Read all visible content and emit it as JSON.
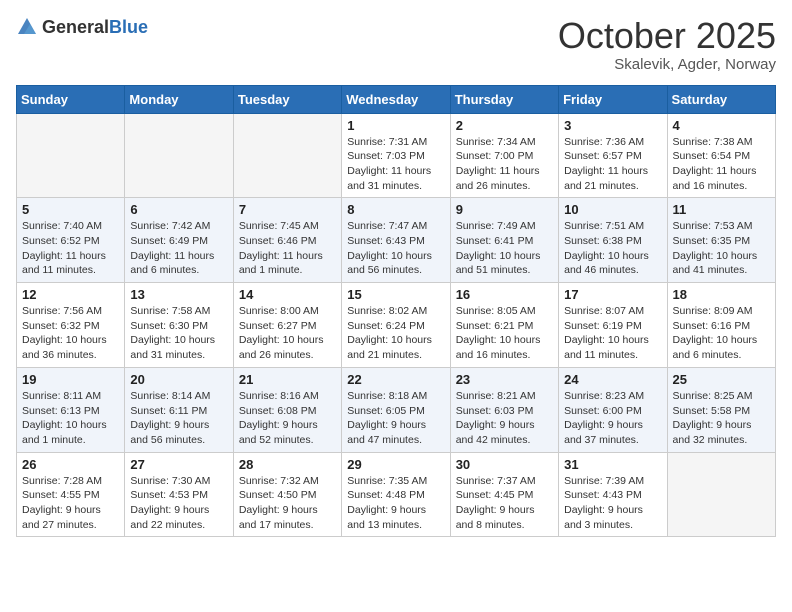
{
  "header": {
    "logo_general": "General",
    "logo_blue": "Blue",
    "month_title": "October 2025",
    "location": "Skalevik, Agder, Norway"
  },
  "weekdays": [
    "Sunday",
    "Monday",
    "Tuesday",
    "Wednesday",
    "Thursday",
    "Friday",
    "Saturday"
  ],
  "weeks": [
    [
      {
        "day": "",
        "info": ""
      },
      {
        "day": "",
        "info": ""
      },
      {
        "day": "",
        "info": ""
      },
      {
        "day": "1",
        "info": "Sunrise: 7:31 AM\nSunset: 7:03 PM\nDaylight: 11 hours\nand 31 minutes."
      },
      {
        "day": "2",
        "info": "Sunrise: 7:34 AM\nSunset: 7:00 PM\nDaylight: 11 hours\nand 26 minutes."
      },
      {
        "day": "3",
        "info": "Sunrise: 7:36 AM\nSunset: 6:57 PM\nDaylight: 11 hours\nand 21 minutes."
      },
      {
        "day": "4",
        "info": "Sunrise: 7:38 AM\nSunset: 6:54 PM\nDaylight: 11 hours\nand 16 minutes."
      }
    ],
    [
      {
        "day": "5",
        "info": "Sunrise: 7:40 AM\nSunset: 6:52 PM\nDaylight: 11 hours\nand 11 minutes."
      },
      {
        "day": "6",
        "info": "Sunrise: 7:42 AM\nSunset: 6:49 PM\nDaylight: 11 hours\nand 6 minutes."
      },
      {
        "day": "7",
        "info": "Sunrise: 7:45 AM\nSunset: 6:46 PM\nDaylight: 11 hours\nand 1 minute."
      },
      {
        "day": "8",
        "info": "Sunrise: 7:47 AM\nSunset: 6:43 PM\nDaylight: 10 hours\nand 56 minutes."
      },
      {
        "day": "9",
        "info": "Sunrise: 7:49 AM\nSunset: 6:41 PM\nDaylight: 10 hours\nand 51 minutes."
      },
      {
        "day": "10",
        "info": "Sunrise: 7:51 AM\nSunset: 6:38 PM\nDaylight: 10 hours\nand 46 minutes."
      },
      {
        "day": "11",
        "info": "Sunrise: 7:53 AM\nSunset: 6:35 PM\nDaylight: 10 hours\nand 41 minutes."
      }
    ],
    [
      {
        "day": "12",
        "info": "Sunrise: 7:56 AM\nSunset: 6:32 PM\nDaylight: 10 hours\nand 36 minutes."
      },
      {
        "day": "13",
        "info": "Sunrise: 7:58 AM\nSunset: 6:30 PM\nDaylight: 10 hours\nand 31 minutes."
      },
      {
        "day": "14",
        "info": "Sunrise: 8:00 AM\nSunset: 6:27 PM\nDaylight: 10 hours\nand 26 minutes."
      },
      {
        "day": "15",
        "info": "Sunrise: 8:02 AM\nSunset: 6:24 PM\nDaylight: 10 hours\nand 21 minutes."
      },
      {
        "day": "16",
        "info": "Sunrise: 8:05 AM\nSunset: 6:21 PM\nDaylight: 10 hours\nand 16 minutes."
      },
      {
        "day": "17",
        "info": "Sunrise: 8:07 AM\nSunset: 6:19 PM\nDaylight: 10 hours\nand 11 minutes."
      },
      {
        "day": "18",
        "info": "Sunrise: 8:09 AM\nSunset: 6:16 PM\nDaylight: 10 hours\nand 6 minutes."
      }
    ],
    [
      {
        "day": "19",
        "info": "Sunrise: 8:11 AM\nSunset: 6:13 PM\nDaylight: 10 hours\nand 1 minute."
      },
      {
        "day": "20",
        "info": "Sunrise: 8:14 AM\nSunset: 6:11 PM\nDaylight: 9 hours\nand 56 minutes."
      },
      {
        "day": "21",
        "info": "Sunrise: 8:16 AM\nSunset: 6:08 PM\nDaylight: 9 hours\nand 52 minutes."
      },
      {
        "day": "22",
        "info": "Sunrise: 8:18 AM\nSunset: 6:05 PM\nDaylight: 9 hours\nand 47 minutes."
      },
      {
        "day": "23",
        "info": "Sunrise: 8:21 AM\nSunset: 6:03 PM\nDaylight: 9 hours\nand 42 minutes."
      },
      {
        "day": "24",
        "info": "Sunrise: 8:23 AM\nSunset: 6:00 PM\nDaylight: 9 hours\nand 37 minutes."
      },
      {
        "day": "25",
        "info": "Sunrise: 8:25 AM\nSunset: 5:58 PM\nDaylight: 9 hours\nand 32 minutes."
      }
    ],
    [
      {
        "day": "26",
        "info": "Sunrise: 7:28 AM\nSunset: 4:55 PM\nDaylight: 9 hours\nand 27 minutes."
      },
      {
        "day": "27",
        "info": "Sunrise: 7:30 AM\nSunset: 4:53 PM\nDaylight: 9 hours\nand 22 minutes."
      },
      {
        "day": "28",
        "info": "Sunrise: 7:32 AM\nSunset: 4:50 PM\nDaylight: 9 hours\nand 17 minutes."
      },
      {
        "day": "29",
        "info": "Sunrise: 7:35 AM\nSunset: 4:48 PM\nDaylight: 9 hours\nand 13 minutes."
      },
      {
        "day": "30",
        "info": "Sunrise: 7:37 AM\nSunset: 4:45 PM\nDaylight: 9 hours\nand 8 minutes."
      },
      {
        "day": "31",
        "info": "Sunrise: 7:39 AM\nSunset: 4:43 PM\nDaylight: 9 hours\nand 3 minutes."
      },
      {
        "day": "",
        "info": ""
      }
    ]
  ]
}
